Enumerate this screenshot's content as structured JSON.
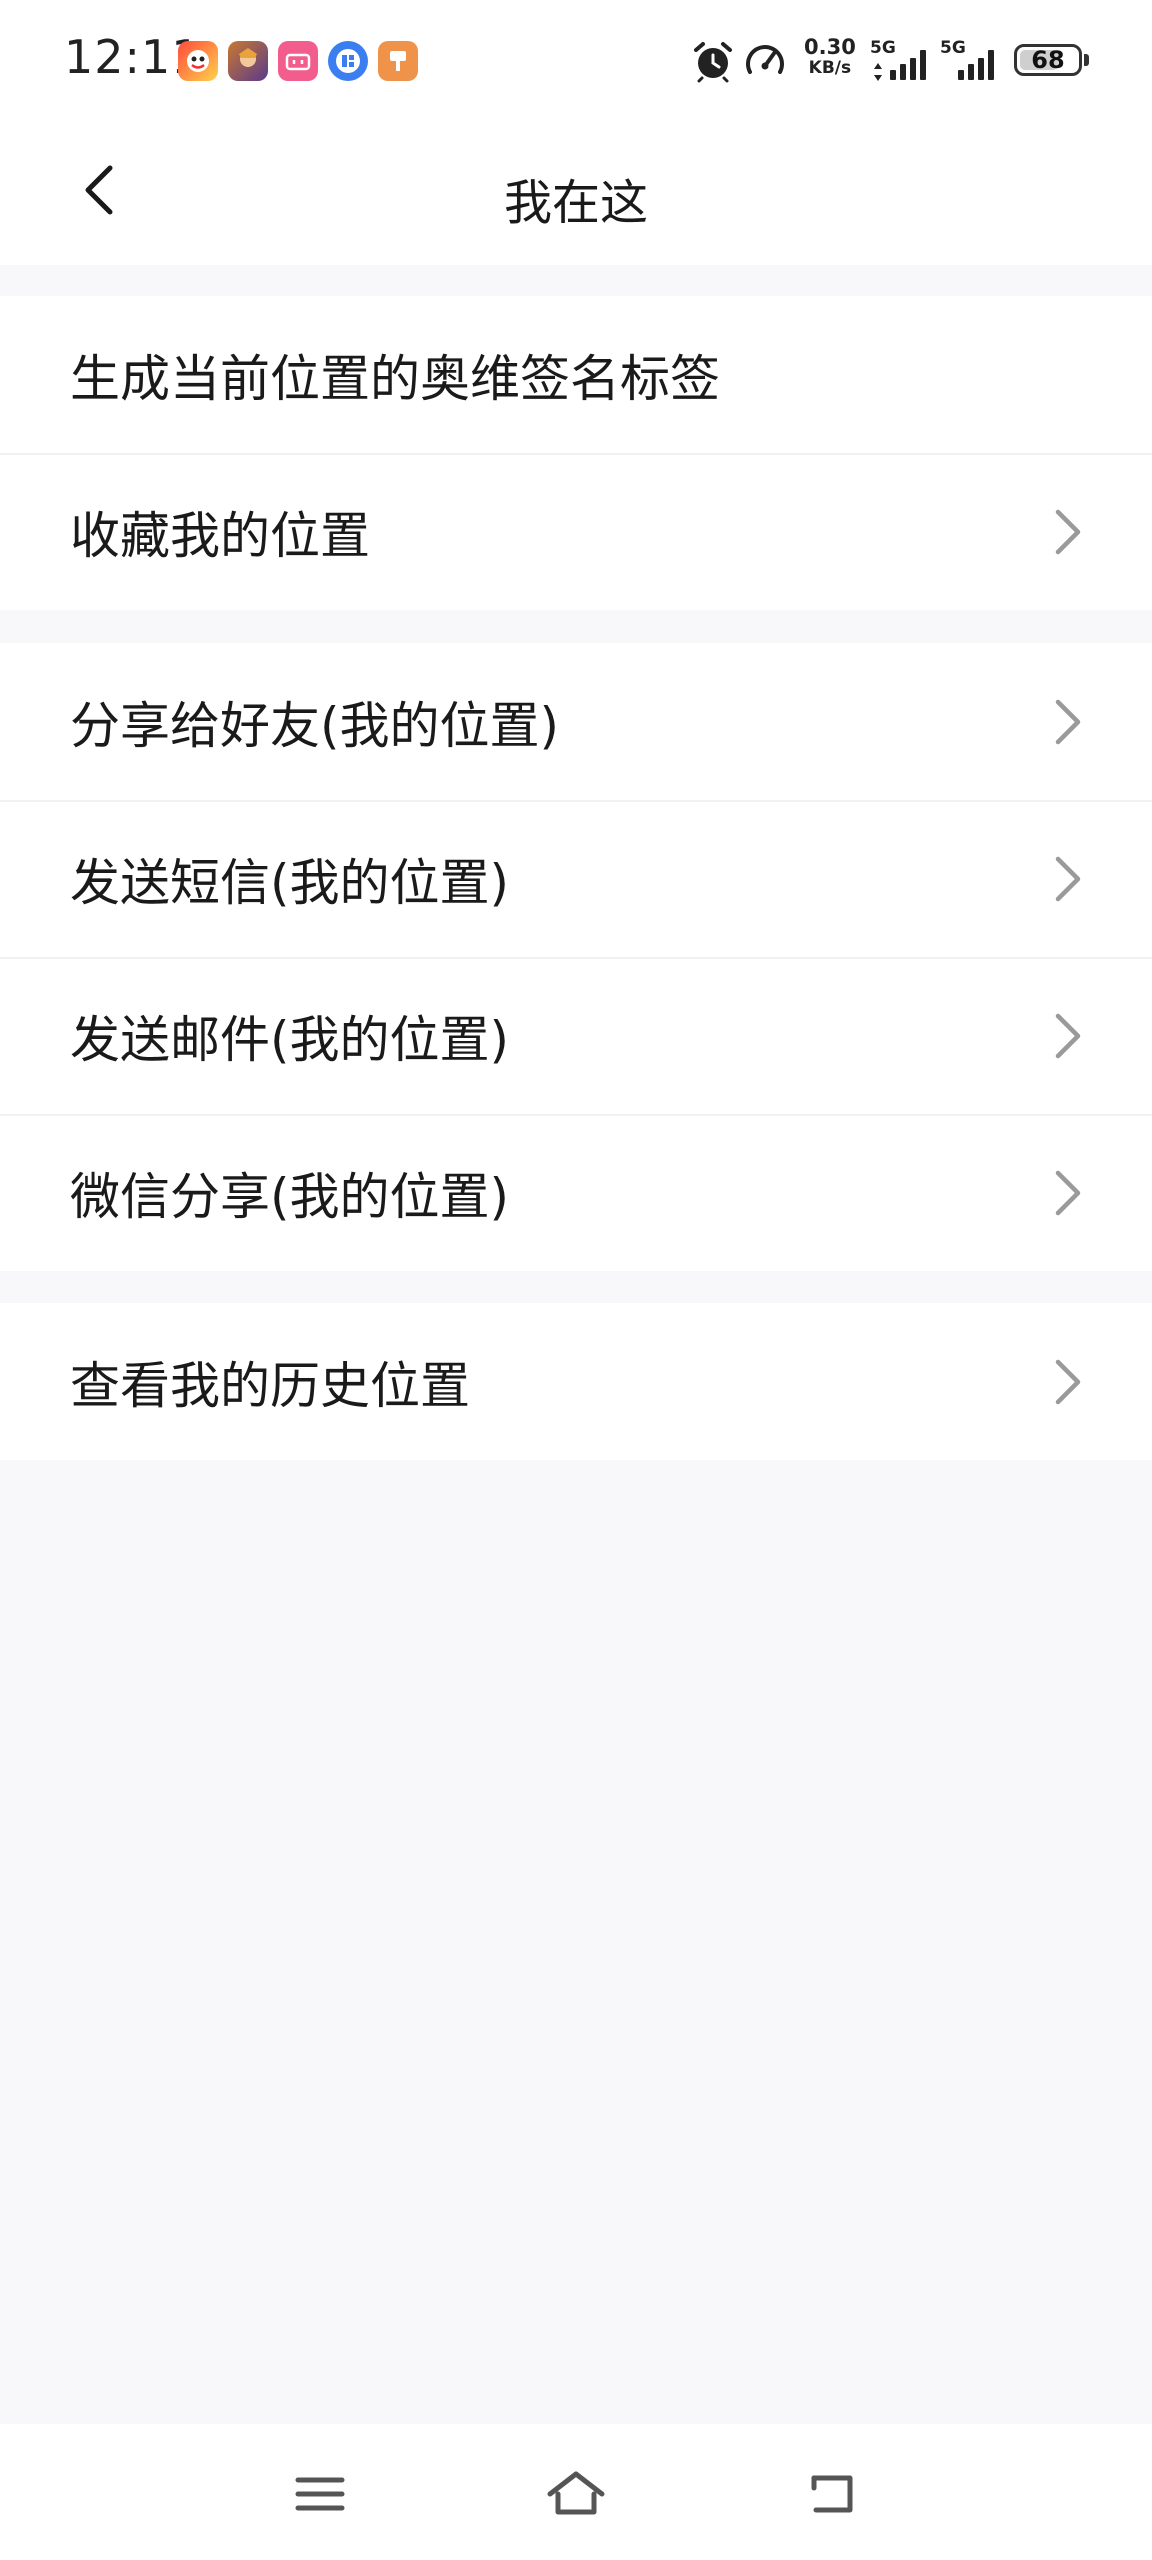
{
  "status_bar": {
    "time": "12:11",
    "net_speed_value": "0.30",
    "net_speed_unit": "KB/s",
    "sim1_label": "5G",
    "sim2_label": "5G",
    "battery_percent": "68",
    "battery_level": 0.68,
    "app_icons": [
      "game-app-icon",
      "hero-game-icon",
      "bilibili-style-app-icon",
      "tieba-app-icon",
      "paint-app-icon"
    ],
    "system_icons": [
      "alarm-icon",
      "speedometer-icon"
    ]
  },
  "nav": {
    "title": "我在这",
    "back_icon": "back-arrow-icon"
  },
  "sections": [
    {
      "items": [
        {
          "label": "生成当前位置的奥维签名标签",
          "has_chevron": false
        },
        {
          "label": "收藏我的位置",
          "has_chevron": true
        }
      ]
    },
    {
      "items": [
        {
          "label": "分享给好友(我的位置)",
          "has_chevron": true
        },
        {
          "label": "发送短信(我的位置)",
          "has_chevron": true
        },
        {
          "label": "发送邮件(我的位置)",
          "has_chevron": true
        },
        {
          "label": "微信分享(我的位置)",
          "has_chevron": true
        }
      ]
    },
    {
      "items": [
        {
          "label": "查看我的历史位置",
          "has_chevron": true
        }
      ]
    }
  ],
  "system_nav": {
    "icons": [
      "menu-icon",
      "home-icon",
      "back-icon"
    ]
  },
  "colors": {
    "background": "#f8f8fa",
    "surface": "#ffffff",
    "text": "#1a1a1a",
    "chevron": "#9a9a9a"
  }
}
